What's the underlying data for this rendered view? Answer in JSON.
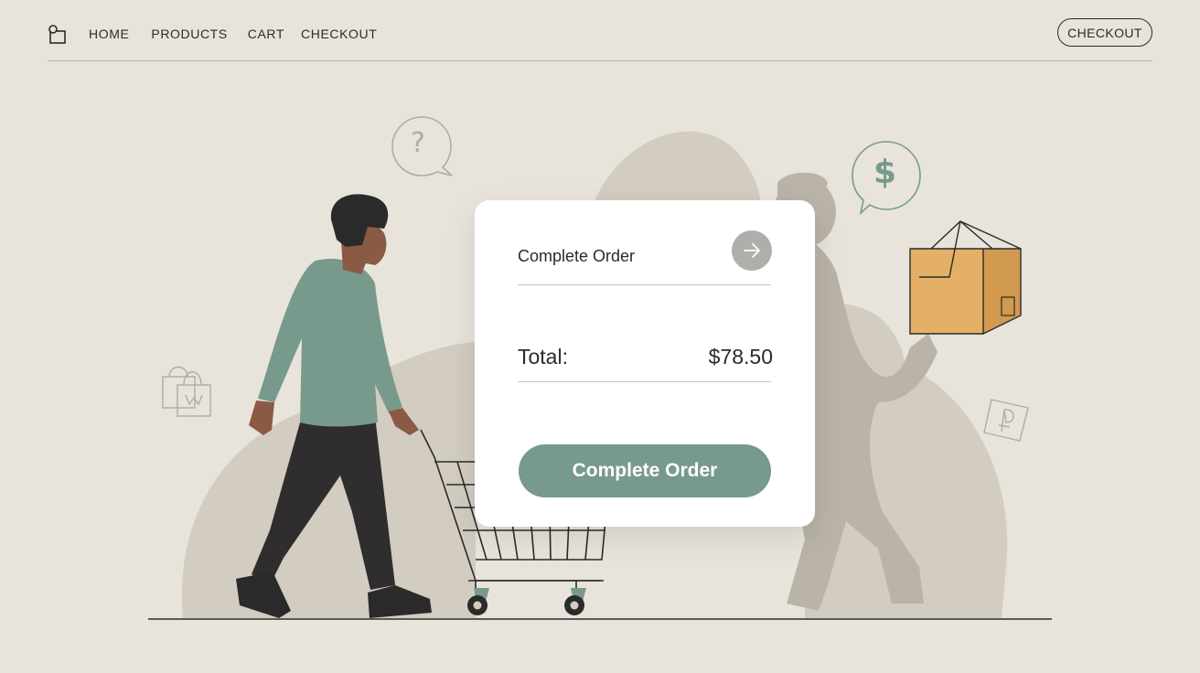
{
  "nav": {
    "links": [
      "HOME",
      "PRODUCTS",
      "CART",
      "CHECKOUT"
    ],
    "cta": "CHECKOUT"
  },
  "card": {
    "title": "Complete Order",
    "total_label": "Total:",
    "total_value": "$78.50",
    "button": "Complete Order"
  },
  "illustration": {
    "question_bubble": "?",
    "dollar_bubble": "$"
  },
  "colors": {
    "background": "#e8e4db",
    "accent": "#779a8d",
    "blob": "#cfc9bd",
    "silhouette": "#b7b1a6",
    "box": "#e3b066"
  }
}
